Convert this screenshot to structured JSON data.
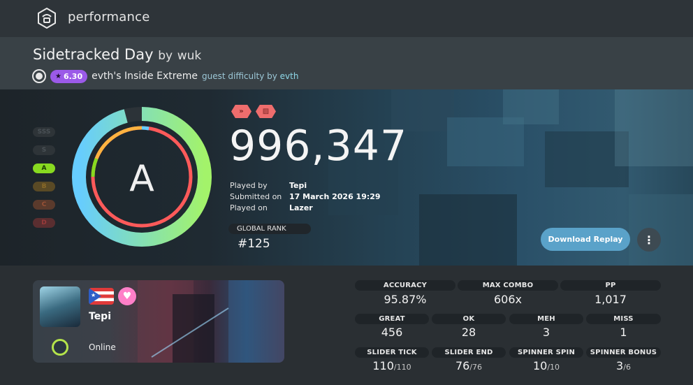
{
  "header": {
    "title": "performance",
    "logo_icon": "performance-icon"
  },
  "beatmap": {
    "title": "Sidetracked Day",
    "by_label": "by",
    "artist": "wuk",
    "mode_icon": "osu-mode-icon",
    "star_rating": "6.30",
    "difficulty": "evth's Inside Extreme",
    "guest_label": "guest difficulty by",
    "guest_mapper": "evth"
  },
  "score": {
    "mods": [
      {
        "name": "nightcore-mod-icon",
        "color": "#ee6d6d"
      },
      {
        "name": "hidden-mod-icon",
        "color": "#ee6d6d"
      }
    ],
    "total": "996,347",
    "grade": "A",
    "accuracy_fraction": 0.9587,
    "ranks": [
      {
        "label": "SSS",
        "active": false
      },
      {
        "label": "S",
        "active": false
      },
      {
        "label": "A",
        "active": true,
        "color": "#88da20"
      },
      {
        "label": "B",
        "active": false,
        "color": "#e3b130"
      },
      {
        "label": "C",
        "active": false,
        "color": "#ff8e5d"
      },
      {
        "label": "D",
        "active": false,
        "color": "#ff5a5a"
      }
    ],
    "played_by_label": "Played by",
    "played_by": "Tepi",
    "submitted_label": "Submitted on",
    "submitted": "17 March 2026 19:29",
    "played_on_label": "Played on",
    "played_on": "Lazer",
    "global_rank_label": "GLOBAL RANK",
    "global_rank": "#125",
    "download_label": "Download Replay",
    "menu_icon": "more-vertical-icon"
  },
  "user": {
    "name": "Tepi",
    "country_flag": "puerto-rico-flag-icon",
    "supporter_icon": "heart-icon",
    "status": "Online",
    "status_color": "#b4e34b"
  },
  "stats": {
    "accuracy_label": "ACCURACY",
    "accuracy": "95.87%",
    "max_combo_label": "MAX COMBO",
    "max_combo": "606x",
    "pp_label": "PP",
    "pp": "1,017",
    "great_label": "GREAT",
    "great": "456",
    "ok_label": "OK",
    "ok": "28",
    "meh_label": "MEH",
    "meh": "3",
    "miss_label": "MISS",
    "miss": "1",
    "slider_tick_label": "SLIDER TICK",
    "slider_tick": "110",
    "slider_tick_max": "/110",
    "slider_end_label": "SLIDER END",
    "slider_end": "76",
    "slider_end_max": "/76",
    "spinner_spin_label": "SPINNER SPIN",
    "spinner_spin": "10",
    "spinner_spin_max": "/10",
    "spinner_bonus_label": "SPINNER BONUS",
    "spinner_bonus": "3",
    "spinner_bonus_max": "/6"
  }
}
